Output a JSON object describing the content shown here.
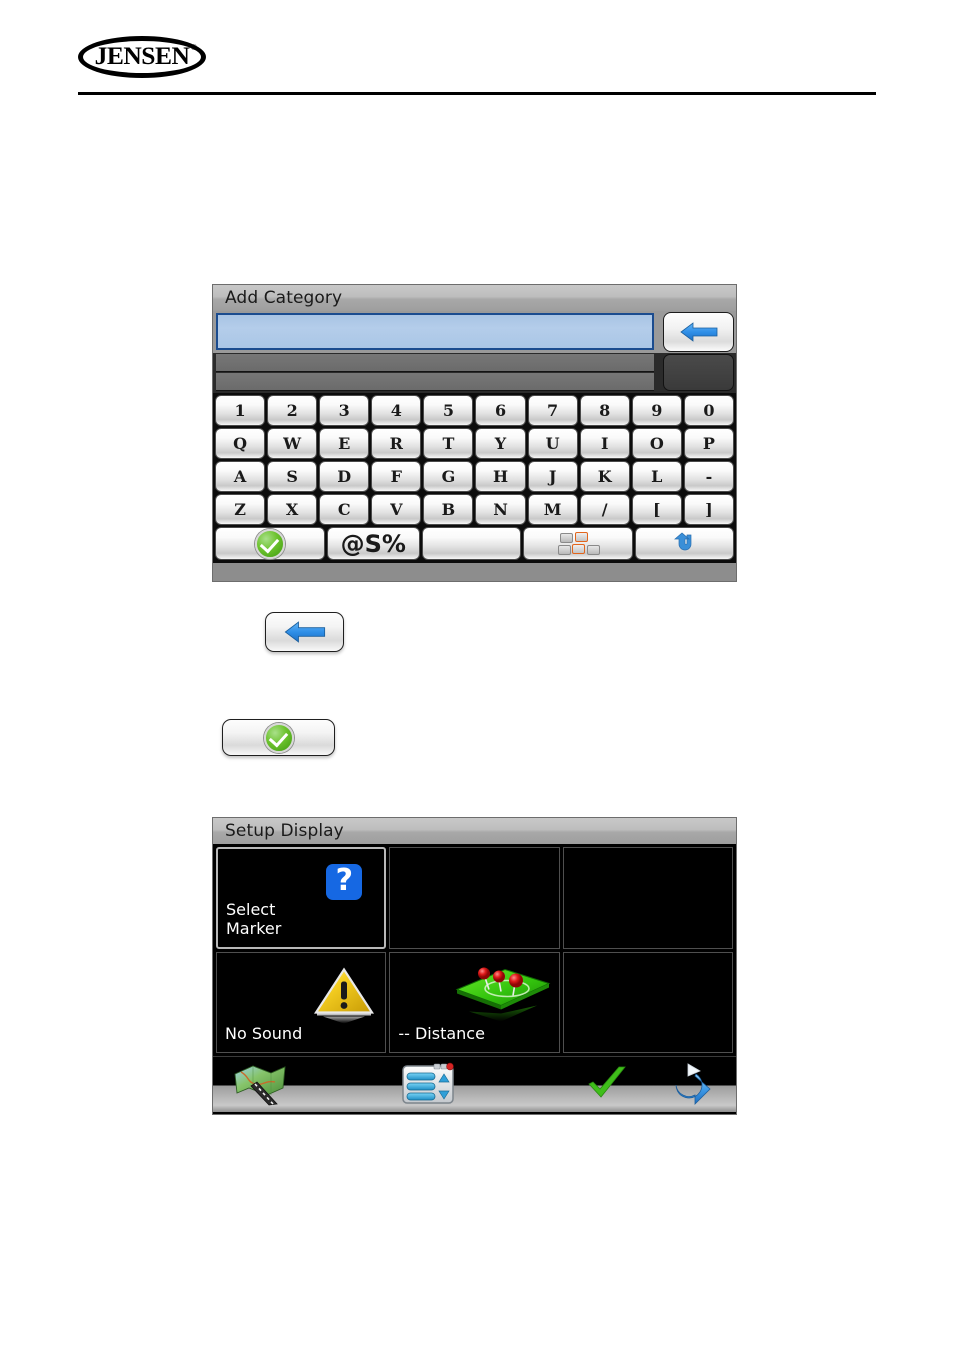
{
  "brand": {
    "name": "JENSEN",
    "registered_mark": "®"
  },
  "keyboard_dialog": {
    "title": "Add Category",
    "input_value": "",
    "backspace_icon": "left-arrow-icon",
    "rows": [
      [
        "1",
        "2",
        "3",
        "4",
        "5",
        "6",
        "7",
        "8",
        "9",
        "0"
      ],
      [
        "Q",
        "W",
        "E",
        "R",
        "T",
        "Y",
        "U",
        "I",
        "O",
        "P"
      ],
      [
        "A",
        "S",
        "D",
        "F",
        "G",
        "H",
        "J",
        "K",
        "L",
        "-"
      ],
      [
        "Z",
        "X",
        "C",
        "V",
        "B",
        "N",
        "M",
        "/",
        "[",
        "]"
      ]
    ],
    "function_row": {
      "ok_icon": "green-check-icon",
      "symbols_label": "@S%",
      "space_label": "",
      "layout_icon": "keyboard-layout-icon",
      "return_icon": "return-arrow-icon"
    }
  },
  "legend": {
    "backspace_icon": "left-arrow-icon",
    "ok_icon": "green-check-icon"
  },
  "setup_display": {
    "title": "Setup Display",
    "cells": [
      {
        "label": "Select\nMarker",
        "label_line1": "Select",
        "label_line2": "Marker",
        "icon": "blue-question-mark-icon",
        "selected": true
      },
      {
        "label": "",
        "icon": "",
        "selected": false
      },
      {
        "label": "",
        "icon": "",
        "selected": false
      },
      {
        "label": "No Sound",
        "icon": "warning-triangle-icon",
        "selected": false
      },
      {
        "label": "-- Distance",
        "icon": "green-plane-pins-icon",
        "selected": false
      },
      {
        "label": "",
        "icon": "",
        "selected": false
      }
    ],
    "toolbar": [
      {
        "name": "map-icon"
      },
      {
        "name": "list-window-icon"
      },
      {
        "name": "green-check-icon"
      },
      {
        "name": "u-turn-arrow-icon"
      }
    ]
  },
  "colors": {
    "input_blue": "#b4cdea",
    "input_border": "#1b4c8f",
    "panel_title_gray": "#b8b8b8",
    "marker_blue": "#1668e3",
    "warning_yellow": "#f2c717",
    "plane_green": "#3cc412",
    "pin_red": "#d81515",
    "check_green": "#3fbe1a",
    "arrow_blue": "#2f8fe8"
  }
}
